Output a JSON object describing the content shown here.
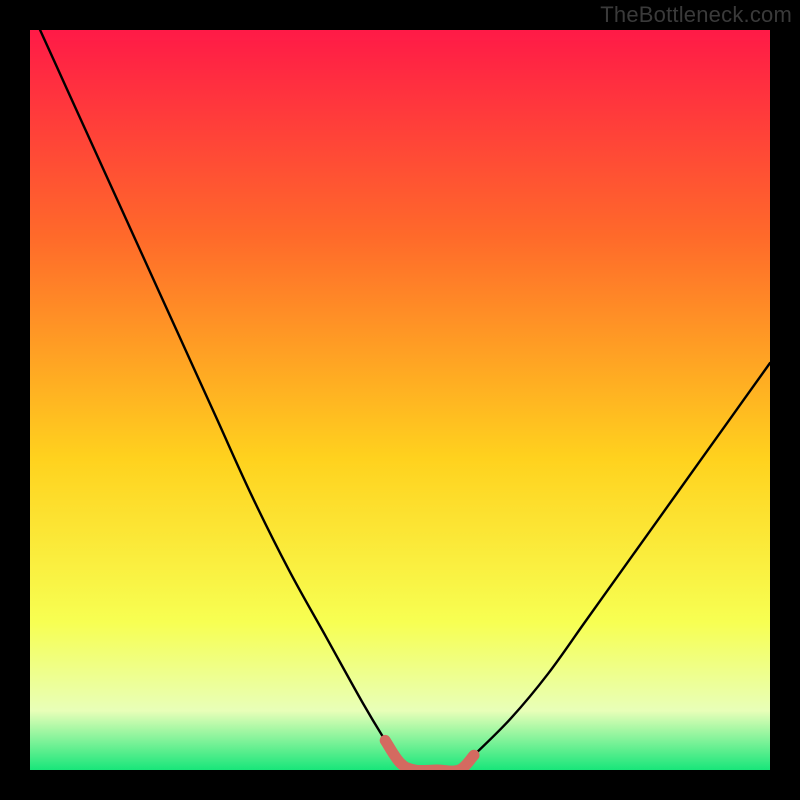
{
  "watermark": {
    "text": "TheBottleneck.com"
  },
  "colors": {
    "background": "#000000",
    "gradient_top": "#ff1a47",
    "gradient_mid_upper": "#ff6a2a",
    "gradient_mid": "#ffd21e",
    "gradient_lower": "#f7ff52",
    "gradient_band_light": "#e8ffb8",
    "gradient_bottom": "#18e67a",
    "curve": "#000000",
    "highlight": "#d46a60"
  },
  "chart_data": {
    "type": "line",
    "title": "",
    "xlabel": "",
    "ylabel": "",
    "xlim": [
      0,
      100
    ],
    "ylim": [
      0,
      100
    ],
    "legend": false,
    "grid": false,
    "series": [
      {
        "name": "bottleneck-curve",
        "x": [
          0,
          5,
          10,
          15,
          20,
          25,
          30,
          35,
          40,
          45,
          48,
          50,
          52,
          55,
          58,
          60,
          65,
          70,
          75,
          80,
          85,
          90,
          95,
          100
        ],
        "values": [
          103,
          92,
          81,
          70,
          59,
          48,
          37,
          27,
          18,
          9,
          4,
          1,
          0,
          0,
          0,
          2,
          7,
          13,
          20,
          27,
          34,
          41,
          48,
          55
        ]
      },
      {
        "name": "optimal-segment",
        "x": [
          48,
          50,
          52,
          55,
          58,
          60
        ],
        "values": [
          4,
          1,
          0,
          0,
          0,
          2
        ]
      }
    ],
    "annotations": []
  }
}
